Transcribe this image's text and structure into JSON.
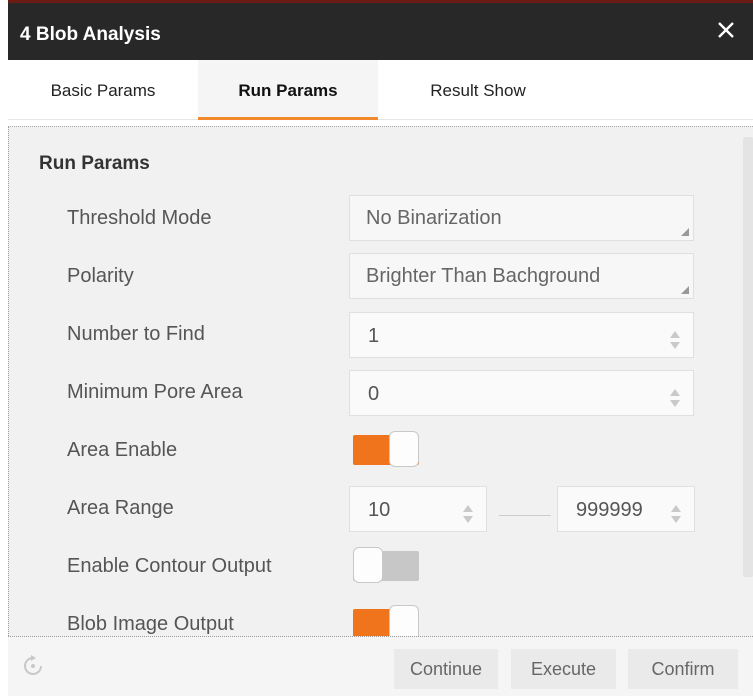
{
  "dialog": {
    "title": "4 Blob Analysis",
    "close_icon": "close-icon"
  },
  "tabs": [
    {
      "label": "Basic Params",
      "active": false
    },
    {
      "label": "Run Params",
      "active": true
    },
    {
      "label": "Result Show",
      "active": false
    }
  ],
  "section": {
    "title": "Run Params"
  },
  "params": {
    "threshold_mode": {
      "label": "Threshold Mode",
      "value": "No Binarization"
    },
    "polarity": {
      "label": "Polarity",
      "value": "Brighter Than Bachground"
    },
    "number_to_find": {
      "label": "Number to Find",
      "value": "1"
    },
    "min_pore_area": {
      "label": "Minimum Pore Area",
      "value": "0"
    },
    "area_enable": {
      "label": "Area Enable",
      "on": true
    },
    "area_range": {
      "label": "Area Range",
      "min": "10",
      "max": "999999"
    },
    "contour_output": {
      "label": "Enable Contour Output",
      "on": false
    },
    "blob_image_output": {
      "label": "Blob Image Output",
      "on": true
    }
  },
  "footer": {
    "refresh_icon": "refresh-icon",
    "continue_label": "Continue",
    "execute_label": "Execute",
    "confirm_label": "Confirm"
  },
  "colors": {
    "accent": "#f0741c",
    "titlebar": "#282828"
  }
}
